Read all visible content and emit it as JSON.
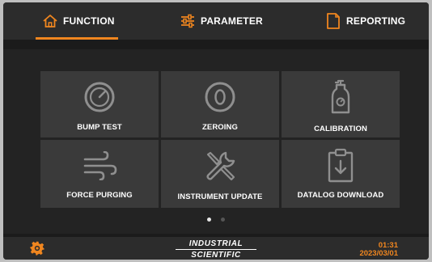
{
  "nav": {
    "tabs": [
      {
        "label": "FUNCTION",
        "icon": "home-icon",
        "active": true
      },
      {
        "label": "PARAMETER",
        "icon": "sliders-icon",
        "active": false
      },
      {
        "label": "REPORTING",
        "icon": "document-icon",
        "active": false
      }
    ]
  },
  "tiles": [
    {
      "label": "BUMP TEST",
      "icon": "gauge-icon"
    },
    {
      "label": "ZEROING",
      "icon": "zero-icon"
    },
    {
      "label": "CALIBRATION",
      "icon": "gas-cylinder-icon"
    },
    {
      "label": "FORCE PURGING",
      "icon": "wind-icon"
    },
    {
      "label": "INSTRUMENT UPDATE",
      "icon": "tools-icon"
    },
    {
      "label": "DATALOG DOWNLOAD",
      "icon": "clipboard-download-icon"
    }
  ],
  "pagination": {
    "pages": 2,
    "current": 1
  },
  "footer": {
    "brand_line1": "INDUSTRIAL",
    "brand_line2": "SCIENTIFIC",
    "time": "01:31",
    "date": "2023/03/01",
    "settings_icon": "gear-icon"
  },
  "colors": {
    "accent": "#f0861f",
    "background": "#1b1b1b",
    "tile": "#3a3a3a",
    "bar": "#2c2c2c"
  }
}
